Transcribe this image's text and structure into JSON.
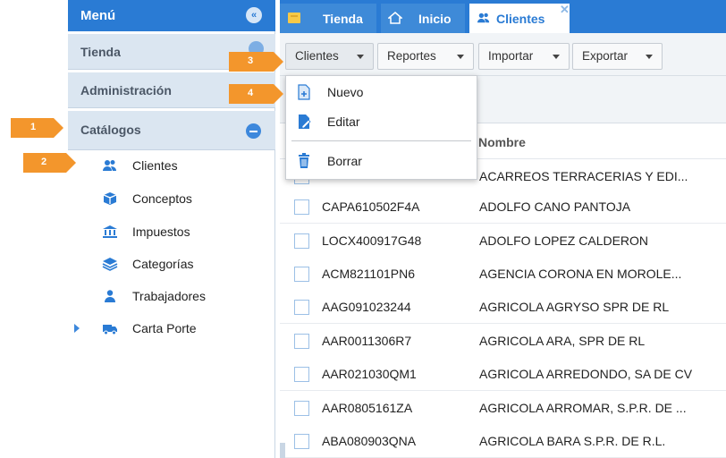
{
  "sidebar": {
    "title": "Menú",
    "sections": [
      "Tienda",
      "Administración",
      "Catálogos"
    ],
    "items": [
      {
        "label": "Clientes",
        "icon": "users-icon"
      },
      {
        "label": "Conceptos",
        "icon": "box-icon"
      },
      {
        "label": "Impuestos",
        "icon": "bank-icon"
      },
      {
        "label": "Categorías",
        "icon": "layers-icon"
      },
      {
        "label": "Trabajadores",
        "icon": "worker-icon"
      },
      {
        "label": "Carta Porte",
        "icon": "truck-icon"
      }
    ]
  },
  "tabs": [
    {
      "label": "Tienda",
      "icon": "store-icon"
    },
    {
      "label": "Inicio",
      "icon": "home-icon"
    },
    {
      "label": "Clientes",
      "icon": "users-icon",
      "active": true
    }
  ],
  "toolbar": {
    "buttons": [
      "Clientes",
      "Reportes",
      "Importar",
      "Exportar"
    ]
  },
  "dropdown": {
    "items": [
      {
        "label": "Nuevo",
        "icon": "new-doc-icon"
      },
      {
        "label": "Editar",
        "icon": "edit-doc-icon"
      },
      {
        "label": "Borrar",
        "icon": "trash-icon"
      }
    ]
  },
  "grid": {
    "column_nombre": "Nombre",
    "rows": [
      {
        "rfc": "",
        "name": "ACARREOS TERRACERIAS Y EDI..."
      },
      {
        "rfc": "CAPA610502F4A",
        "name": "ADOLFO CANO PANTOJA"
      },
      {
        "rfc": "LOCX400917G48",
        "name": "ADOLFO LOPEZ CALDERON"
      },
      {
        "rfc": "ACM821101PN6",
        "name": "AGENCIA CORONA EN MOROLE..."
      },
      {
        "rfc": "AAG091023244",
        "name": "AGRICOLA AGRYSO SPR DE RL"
      },
      {
        "rfc": "AAR0011306R7",
        "name": "AGRICOLA ARA, SPR DE RL"
      },
      {
        "rfc": "AAR021030QM1",
        "name": "AGRICOLA ARREDONDO, SA DE CV"
      },
      {
        "rfc": "AAR0805161ZA",
        "name": "AGRICOLA ARROMAR, S.P.R. DE ..."
      },
      {
        "rfc": "ABA080903QNA",
        "name": "AGRICOLA BARA S.P.R. DE R.L."
      }
    ]
  },
  "callouts": [
    "1",
    "2",
    "3",
    "4"
  ],
  "colors": {
    "accent": "#2a7bd4",
    "callout": "#f3962c",
    "sidebar_section": "#dbe6f1"
  }
}
